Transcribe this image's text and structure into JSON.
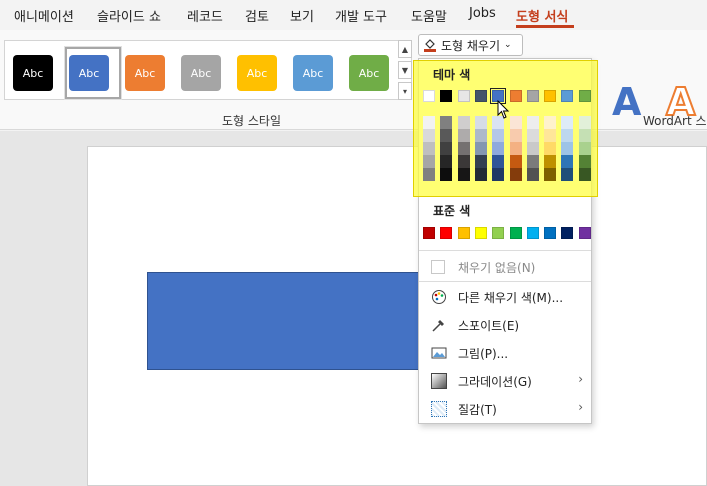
{
  "menubar": {
    "tabs": [
      "애니메이션",
      "슬라이드 쇼",
      "레코드",
      "검토",
      "보기",
      "개발 도구",
      "도움말",
      "Jobs",
      "도형 서식"
    ],
    "active": "도형 서식"
  },
  "ribbon": {
    "swatch_label": "Abc",
    "swatch_colors": [
      "#000000",
      "#4472c4",
      "#ed7d31",
      "#a5a5a5",
      "#ffc000",
      "#5b9bd5",
      "#70ad47"
    ],
    "group_label": "도형 스타일",
    "fill_button": "도형 채우기",
    "wordart_letter": "A",
    "wordart_label": "WordArt 스"
  },
  "dropdown": {
    "theme_title": "테마 색",
    "theme_top_row": [
      "#ffffff",
      "#000000",
      "#e7e6e6",
      "#44546a",
      "#4472c4",
      "#ed7d31",
      "#a5a5a5",
      "#ffc000",
      "#5b9bd5",
      "#70ad47"
    ],
    "theme_shades": [
      [
        "#f2f2f2",
        "#808080",
        "#d0cece",
        "#d6dce5",
        "#dae3f3",
        "#fbe5d6",
        "#ededed",
        "#fff2cc",
        "#deebf7",
        "#e2f0d9"
      ],
      [
        "#d9d9d9",
        "#595959",
        "#aeabab",
        "#adb9ca",
        "#b4c7e7",
        "#f8cbad",
        "#dbdbdb",
        "#ffe699",
        "#bdd7ee",
        "#c5e0b4"
      ],
      [
        "#bfbfbf",
        "#404040",
        "#757171",
        "#8497b0",
        "#8faadc",
        "#f4b183",
        "#c9c9c9",
        "#ffd966",
        "#9dc3e6",
        "#a9d18e"
      ],
      [
        "#a6a6a6",
        "#262626",
        "#3b3838",
        "#333f50",
        "#2f5597",
        "#c55a11",
        "#7b7b7b",
        "#bf9000",
        "#2e75b6",
        "#548235"
      ],
      [
        "#808080",
        "#0d0d0d",
        "#171616",
        "#222a35",
        "#203864",
        "#843c0c",
        "#525252",
        "#7f6000",
        "#1f4e79",
        "#385723"
      ]
    ],
    "standard_title": "표준 색",
    "standard_colors": [
      "#c00000",
      "#ff0000",
      "#ffc000",
      "#ffff00",
      "#92d050",
      "#00b050",
      "#00b0f0",
      "#0070c0",
      "#002060",
      "#7030a0"
    ],
    "items": {
      "no_fill": "채우기 없음(N)",
      "more_colors": "다른 채우기 색(M)...",
      "eyedropper": "스포이트(E)",
      "picture": "그림(P)...",
      "gradient": "그라데이션(G)",
      "texture": "질감(T)"
    }
  },
  "colors": {
    "accent": "#c43e1c",
    "highlight": "#ffff3c",
    "shape_fill": "#4472c4"
  }
}
